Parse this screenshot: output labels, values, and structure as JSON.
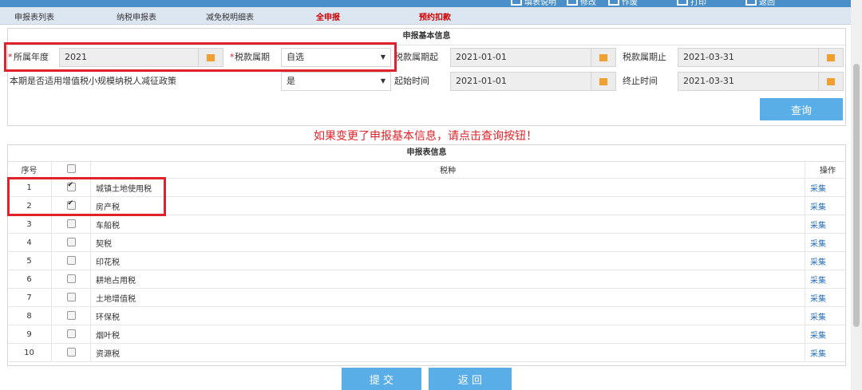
{
  "toolbar": {
    "buttons": [
      "填表说明",
      "修改",
      "作废",
      "打印",
      "返回"
    ]
  },
  "tabs": [
    "申报表列表",
    "纳税申报表",
    "减免税明细表",
    "全申报",
    "预约扣款"
  ],
  "basic": {
    "title": "申报基本信息",
    "year_label": "所属年度",
    "year_value": "2021",
    "period_label": "税款属期",
    "period_value": "自选",
    "period_start_label": "税款属期起",
    "period_start_value": "2021-01-01",
    "period_end_label": "税款属期止",
    "period_end_value": "2021-03-31",
    "policy_label": "本期是否适用增值税小规模纳税人减征政策",
    "policy_value": "是",
    "start_label": "起始时间",
    "start_value": "2021-01-01",
    "end_label": "终止时间",
    "end_value": "2021-03-31",
    "required_mark": "*",
    "query_button": "查询"
  },
  "notice": "如果变更了申报基本信息，请点击查询按钮！",
  "forms": {
    "title": "申报表信息",
    "headers": {
      "index": "序号",
      "tax": "税种",
      "op": "操作"
    },
    "rows": [
      {
        "index": "1",
        "tax": "城镇土地使用税",
        "checked": true,
        "op": "采集"
      },
      {
        "index": "2",
        "tax": "房产税",
        "checked": true,
        "op": "采集"
      },
      {
        "index": "3",
        "tax": "车船税",
        "checked": false,
        "op": "采集"
      },
      {
        "index": "4",
        "tax": "契税",
        "checked": false,
        "op": "采集"
      },
      {
        "index": "5",
        "tax": "印花税",
        "checked": false,
        "op": "采集"
      },
      {
        "index": "6",
        "tax": "耕地占用税",
        "checked": false,
        "op": "采集"
      },
      {
        "index": "7",
        "tax": "土地增值税",
        "checked": false,
        "op": "采集"
      },
      {
        "index": "8",
        "tax": "环保税",
        "checked": false,
        "op": "采集"
      },
      {
        "index": "9",
        "tax": "烟叶税",
        "checked": false,
        "op": "采集"
      },
      {
        "index": "10",
        "tax": "资源税",
        "checked": false,
        "op": "采集"
      }
    ]
  },
  "actions": {
    "submit": "提 交",
    "back": "返 回"
  },
  "colors": {
    "accent": "#5aaee8",
    "highlight": "#e0232a"
  }
}
